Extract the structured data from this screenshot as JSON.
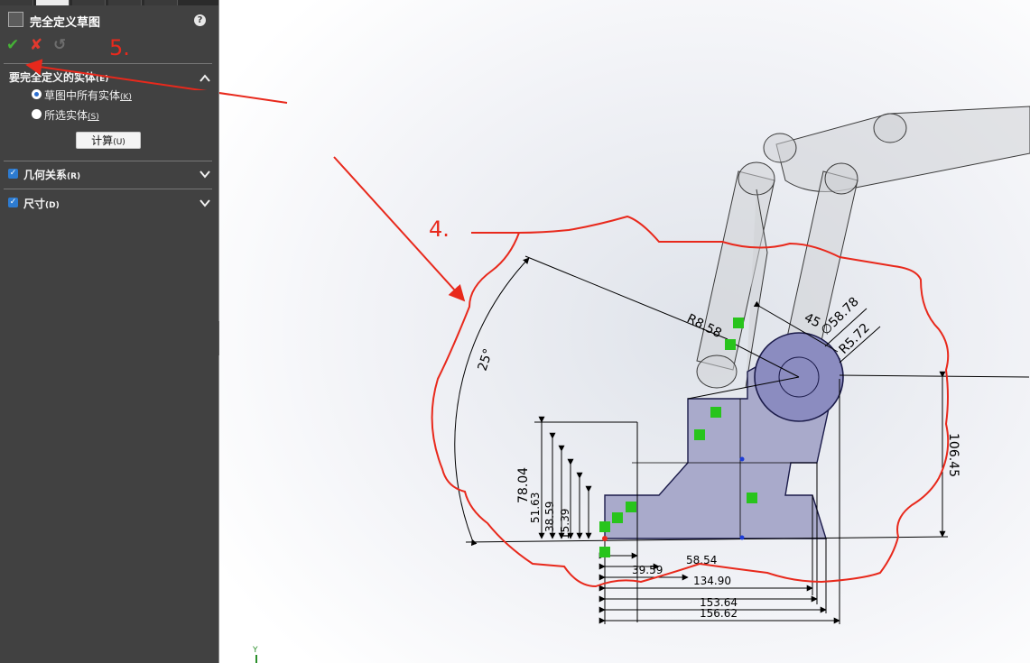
{
  "property_manager": {
    "title": "完全定义草图",
    "help_glyph": "?",
    "actions": {
      "ok_glyph": "✔",
      "cancel_glyph": "✘",
      "undo_glyph": "↺"
    }
  },
  "sections": {
    "entities": {
      "label": "要完全定义的实体",
      "shortcut": "(E)",
      "options": [
        {
          "label": "草图中所有实体",
          "shortcut": "(K)",
          "selected": true
        },
        {
          "label": "所选实体",
          "shortcut": "(S)",
          "selected": false
        }
      ],
      "calculate_label": "计算",
      "calculate_shortcut": "(U)"
    },
    "relations": {
      "label": "几何关系",
      "shortcut": "(R)",
      "checked": true
    },
    "dimensions": {
      "label": "尺寸",
      "shortcut": "(D)",
      "checked": true
    }
  },
  "annotations": {
    "step4": "4.",
    "step5": "5."
  },
  "sketch": {
    "dims": {
      "angle": "25°",
      "radius1": "R8.58",
      "angle45": "45",
      "diameter": "∅58.78",
      "radius2": "R5.72",
      "height": "106.45",
      "v1": "78.04",
      "v2": "51.63",
      "v3": "38.59",
      "v4": "15.39",
      "bottom": "156.62",
      "bottom2": "153.64",
      "bottom3": "134.90",
      "ghost1": "58.54",
      "ghost2": "39.59"
    }
  },
  "axis_label": "Y",
  "colors": {
    "panel_bg": "#414141",
    "accent_red": "#e8291c",
    "sketch_fill": "#a9aacb",
    "ok_green": "#45b236",
    "relation_green": "#28c41c"
  }
}
